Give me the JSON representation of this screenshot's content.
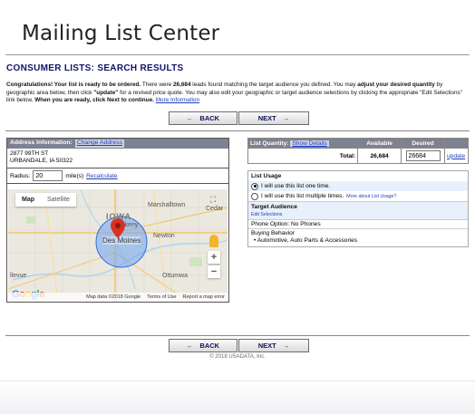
{
  "app_title": "Mailing List Center",
  "heading": "CONSUMER LISTS: SEARCH RESULTS",
  "intro": {
    "p1_bold": "Congratulations! Your list is ready to be ordered.",
    "p2": " There were ",
    "count": "26,684",
    "p3": " leads found matching the target audience you defined. You may ",
    "p4_bold": "adjust your desired quantity",
    "p5": " by geographic area below, then click ",
    "p6_bold": "\"update\"",
    "p7": " for a revised price quote. You may also edit your geographic or target audience selections by clicking the appropriate \"Edit Selections\" link below. ",
    "p8_bold": "When you are ready, click Next to continue.",
    "link": "More Information"
  },
  "nav": {
    "back": "BACK",
    "next": "NEXT",
    "back_arrow": "←",
    "next_arrow": "→"
  },
  "address_panel": {
    "header": "Address Information:",
    "change_link": "Change Address",
    "line1": "2877 99TH ST",
    "line2": "URBANDALE, IA 50322",
    "radius_label": "Radius:",
    "radius_value": "20",
    "radius_unit": "mile(s)",
    "recalc_link": "Recalculate"
  },
  "map": {
    "tab_map": "Map",
    "tab_satellite": "Satellite",
    "labels": {
      "state": "IOWA",
      "city": "Des Moines",
      "marshalltown": "Marshalltown",
      "cedar": "Cedar",
      "ankeny": "Ankeny",
      "newton": "Newton",
      "ottumwa": "Ottumwa",
      "bellevue": "llevue"
    },
    "zoom_in": "+",
    "zoom_out": "−",
    "fullscreen": "⛶",
    "google": [
      "G",
      "o",
      "o",
      "g",
      "l",
      "e"
    ],
    "footer_data": "Map data ©2018 Google",
    "footer_terms": "Terms of Use",
    "footer_report": "Report a map error"
  },
  "quantity_table": {
    "header_label": "List Quantity:",
    "show_details": "Show Details",
    "col_available": "Available",
    "col_desired": "Desired",
    "total_label": "Total:",
    "available": "26,684",
    "desired": "26684",
    "update_link": "update"
  },
  "usage": {
    "title": "List Usage",
    "option1": "I will use this list one time.",
    "option2": "I will use this list multiple times.",
    "more_link": "More about List Usage?",
    "target_title": "Target Audience",
    "edit_link": "Edit Selections",
    "phone_option": "Phone Option: No Phones",
    "buying_title": "Buying Behavior",
    "buying_items": [
      "Automotive, Auto Parts & Accessories"
    ]
  },
  "copyright": "© 2018 USADATA, Inc.",
  "colors": {
    "header_bg": "#7d8190",
    "heading": "#13136b",
    "link": "#1f3fb5",
    "pin": "#d93025",
    "circle": "#5b8fe0"
  }
}
